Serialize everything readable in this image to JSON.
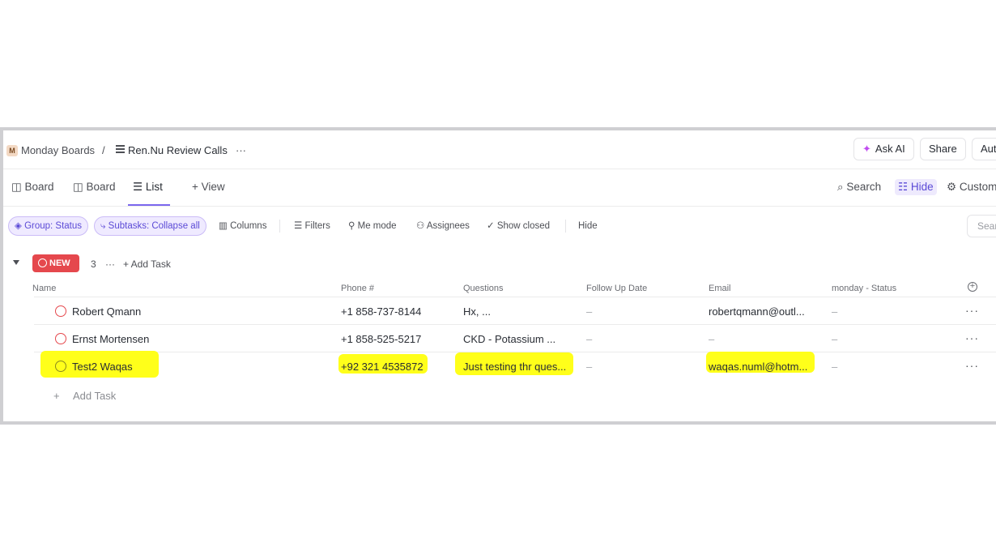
{
  "breadcrumb": {
    "workspace_initial": "M",
    "workspace": "Monday Boards",
    "separator": "/",
    "list_name": "Ren.Nu Review Calls",
    "more": "···"
  },
  "header_actions": {
    "ask_ai": "Ask AI",
    "share": "Share",
    "automations_partial": "Aut"
  },
  "view_tabs": [
    {
      "label": "Board"
    },
    {
      "label": "Board"
    },
    {
      "label": "List"
    },
    {
      "label": "+ View"
    }
  ],
  "view_tools": {
    "search": "Search",
    "hide": "Hide",
    "customize_partial": "Custom"
  },
  "filters": {
    "group": "Group: Status",
    "subtasks": "Subtasks: Collapse all",
    "columns": "Columns",
    "filters": "Filters",
    "me_mode": "Me mode",
    "assignees": "Assignees",
    "show_closed": "Show closed",
    "hide": "Hide",
    "search_placeholder": "Sear"
  },
  "group": {
    "status": "NEW",
    "count": "3",
    "more": "···",
    "add_task": "+ Add Task"
  },
  "columns": [
    "Name",
    "Phone #",
    "Questions",
    "Follow Up Date",
    "Email",
    "monday - Status"
  ],
  "rows": [
    {
      "name": "Robert Qmann",
      "phone": "+1 858-737-8144",
      "questions": "Hx, ...",
      "follow_up": "–",
      "email": "robertqmann@outl...",
      "status": "–",
      "highlighted": false
    },
    {
      "name": "Ernst Mortensen",
      "phone": "+1 858-525-5217",
      "questions": "CKD - Potassium ...",
      "follow_up": "–",
      "email": "–",
      "status": "–",
      "highlighted": false
    },
    {
      "name": "Test2 Waqas",
      "phone": "+92 321 4535872",
      "questions": "Just testing thr ques...",
      "follow_up": "–",
      "email": "waqas.numl@hotm...",
      "status": "–",
      "highlighted": true
    }
  ],
  "row_more": "···",
  "add_task_row": "Add Task",
  "colors": {
    "accent": "#7b68ee",
    "status_new": "#e5484d",
    "highlight": "#ffff1a"
  }
}
